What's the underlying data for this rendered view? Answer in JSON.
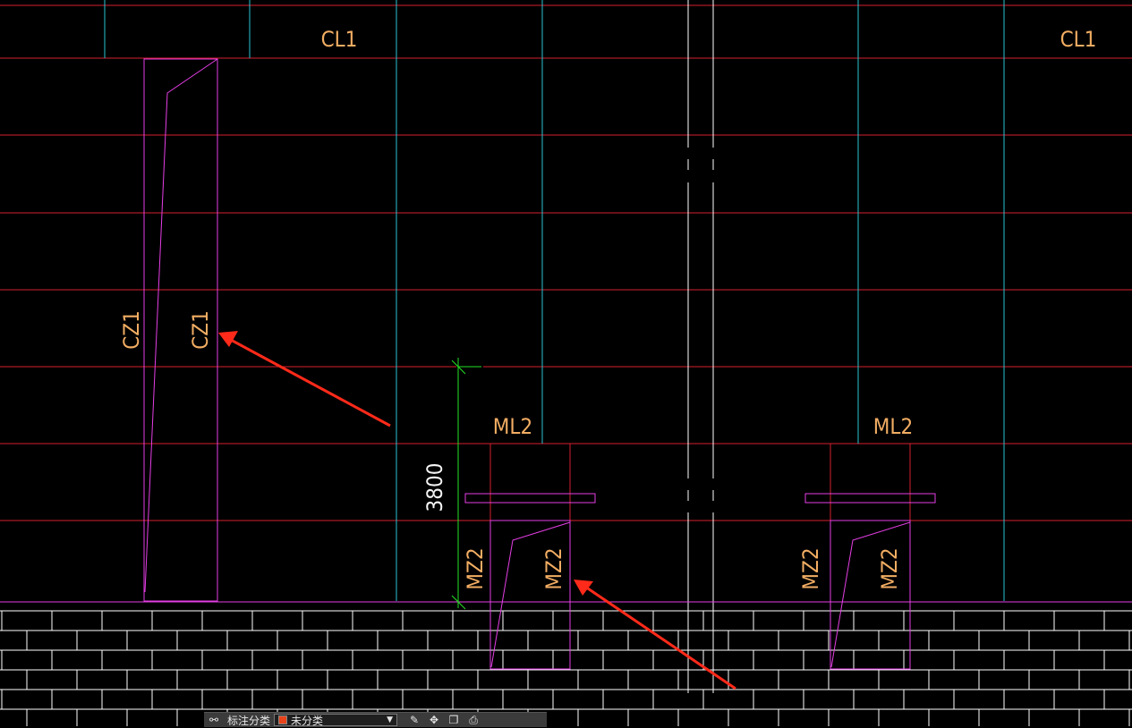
{
  "labels": {
    "cl1_left": "CL1",
    "cl1_right": "CL1",
    "cz1_outer": "CZ1",
    "cz1_inner": "CZ1",
    "ml2_left": "ML2",
    "ml2_right": "ML2",
    "mz2_a": "MZ2",
    "mz2_b": "MZ2",
    "mz2_c": "MZ2",
    "mz2_d": "MZ2",
    "dimension": "3800"
  },
  "toolbar": {
    "filter_icon": "filter-icon",
    "category_label": "标注分类",
    "category_value": "未分类",
    "category_color": "#e8431a",
    "tool_icons": [
      "edit-icon",
      "move-icon",
      "copy-icon",
      "print-icon"
    ]
  },
  "colors": {
    "background": "#000000",
    "grid_red": "#d42030",
    "grid_cyan": "#27c3d2",
    "outline_magenta": "#e53ee5",
    "text_orange": "#f2ad63",
    "dimension_green": "#25e025",
    "annotation_arrow": "#ff2a1a",
    "brick_white": "#ffffff"
  }
}
